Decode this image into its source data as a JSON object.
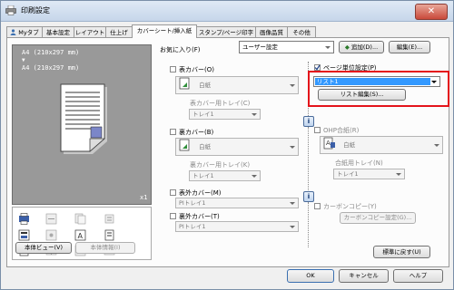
{
  "window": {
    "title": "印刷設定",
    "close_label": "✕"
  },
  "tabs": [
    "Myタブ",
    "基本設定",
    "レイアウト",
    "仕上げ",
    "カバーシート/挿入紙",
    "スタンプ/ページ印字",
    "画像品質",
    "その他"
  ],
  "active_tab": "カバーシート/挿入紙",
  "preview": {
    "line1": "A4 (210x297 mm)",
    "arrow": "▼",
    "line2": "A4 (210x297 mm)",
    "scale": "x1"
  },
  "left_buttons": {
    "view": "本体ビュー(V)",
    "info": "本体情報(I)"
  },
  "favorites": {
    "label": "お気に入り(F)",
    "value": "ユーザー設定",
    "add": "追加(D)...",
    "edit": "編集(E)..."
  },
  "front_cover": {
    "label": "表カバー(O)",
    "paper": "白紙",
    "tray_label": "表カバー用トレイ(C)",
    "tray_value": "トレイ1"
  },
  "back_cover": {
    "label": "裏カバー(B)",
    "paper": "白紙",
    "tray_label": "裏カバー用トレイ(K)",
    "tray_value": "トレイ1"
  },
  "pi_front": {
    "label": "表外カバー(M)",
    "value": "PIトレイ1"
  },
  "pi_back": {
    "label": "裏外カバー(T)",
    "value": "PIトレイ1"
  },
  "page_setting": {
    "label": "ページ単位設定(P)",
    "value": "リスト1",
    "edit_button": "リスト編集(S)..."
  },
  "ohp": {
    "label": "OHP合紙(R)",
    "paper": "白紙",
    "tray_label": "合紙用トレイ(N)",
    "tray_value": "トレイ1"
  },
  "carbon": {
    "label": "カーボンコピー(Y)",
    "button": "カーボンコピー設定(G)..."
  },
  "restore_default": "標準に戻す(U)",
  "footer": {
    "ok": "OK",
    "cancel": "キャンセル",
    "help": "ヘルプ"
  },
  "colors": {
    "highlight_border": "#e4141b",
    "selection": "#3399ff",
    "title_gradient": "#c6d6ea"
  }
}
